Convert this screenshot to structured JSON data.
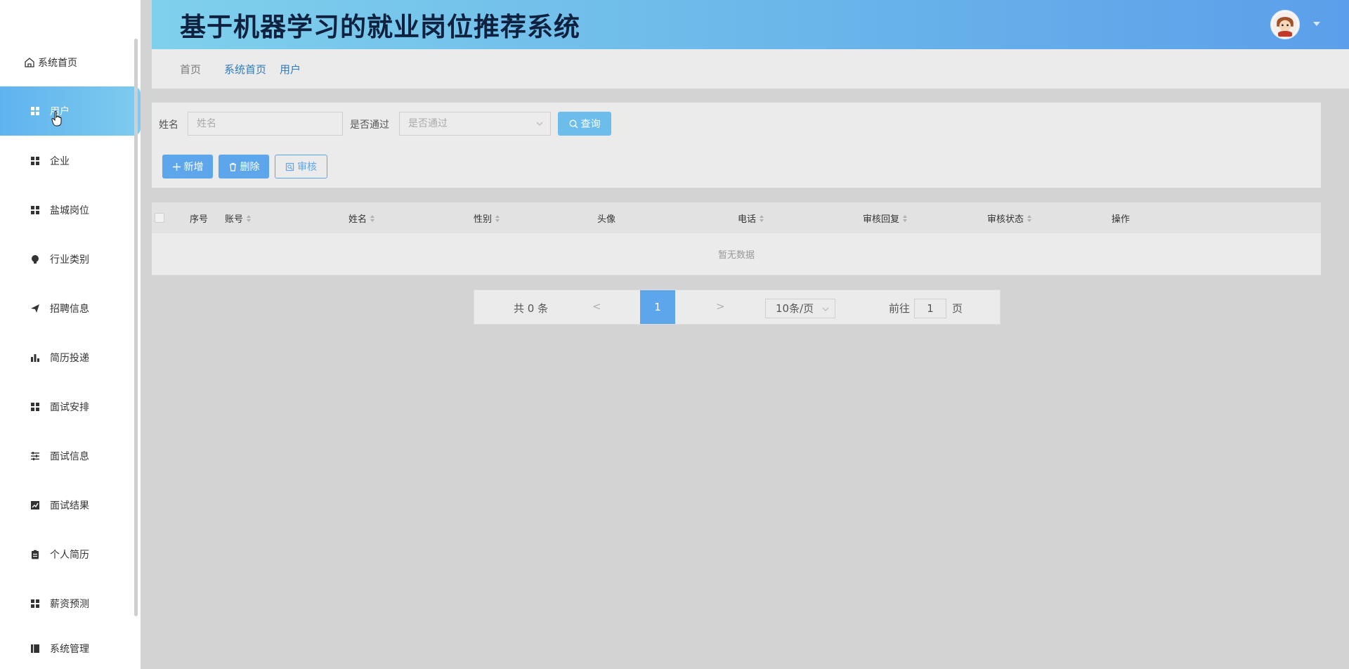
{
  "app": {
    "title": "基于机器学习的就业岗位推荐系统"
  },
  "sidebar": {
    "home_label": "系统首页",
    "items": [
      {
        "label": "用户",
        "icon": "grid-icon",
        "active": true
      },
      {
        "label": "企业",
        "icon": "grid-icon"
      },
      {
        "label": "盐城岗位",
        "icon": "grid-icon"
      },
      {
        "label": "行业类别",
        "icon": "bulb-icon"
      },
      {
        "label": "招聘信息",
        "icon": "send-icon"
      },
      {
        "label": "简历投递",
        "icon": "bar-chart-icon"
      },
      {
        "label": "面试安排",
        "icon": "grid-icon"
      },
      {
        "label": "面试信息",
        "icon": "sliders-icon"
      },
      {
        "label": "面试结果",
        "icon": "trend-chart-icon"
      },
      {
        "label": "个人简历",
        "icon": "clipboard-icon"
      },
      {
        "label": "薪资预测",
        "icon": "grid-icon"
      },
      {
        "label": "系统管理",
        "icon": "book-icon"
      }
    ]
  },
  "breadcrumb": {
    "home": "首页",
    "items": [
      "系统首页",
      "用户"
    ]
  },
  "search": {
    "name_label": "姓名",
    "name_placeholder": "姓名",
    "pass_label": "是否通过",
    "pass_placeholder": "是否通过",
    "query_button": "查询"
  },
  "actions": {
    "add": "新增",
    "delete": "删除",
    "audit": "审核"
  },
  "table": {
    "columns": [
      "序号",
      "账号",
      "姓名",
      "性别",
      "头像",
      "电话",
      "审核回复",
      "审核状态",
      "操作"
    ],
    "empty_text": "暂无数据"
  },
  "pagination": {
    "total": "共 0 条",
    "prev": "<",
    "current_page": "1",
    "next": ">",
    "page_size": "10条/页",
    "goto_label": "前往",
    "goto_value": "1",
    "goto_unit": "页"
  },
  "colors": {
    "accent": "#5ea6ec",
    "header_gradient_start": "#7fd0ec",
    "header_gradient_end": "#5b9fea"
  }
}
